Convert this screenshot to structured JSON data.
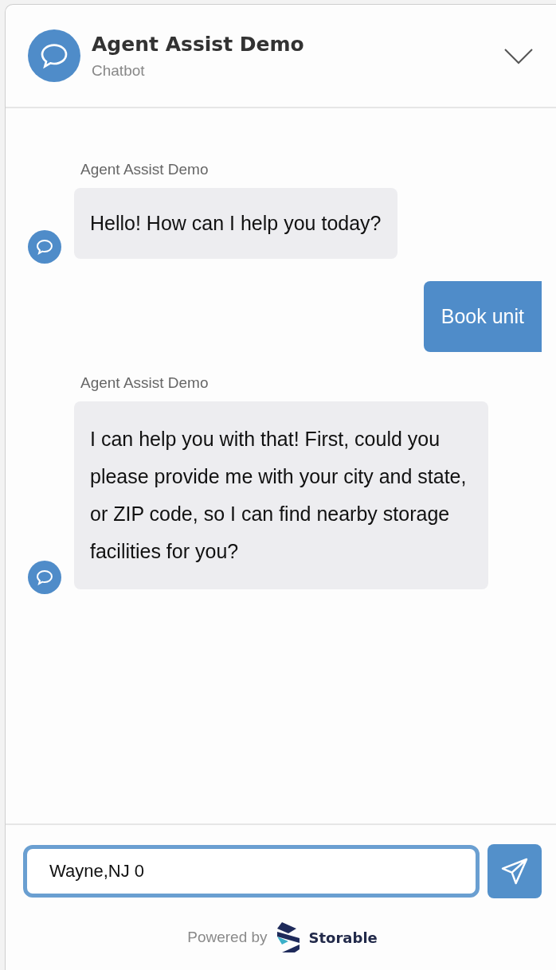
{
  "header": {
    "title": "Agent Assist Demo",
    "subtitle": "Chatbot",
    "expanded": true
  },
  "messages": [
    {
      "kind": "bot",
      "sender": "Agent Assist Demo",
      "text": "Hello! How can I help you today?"
    },
    {
      "kind": "user",
      "text": "Book unit"
    },
    {
      "kind": "bot",
      "sender": "Agent Assist Demo",
      "text": "I can help you with that! First, could you please provide me with your city and state, or ZIP code, so I can find nearby storage facilities for you?"
    }
  ],
  "composer": {
    "value": "Wayne,NJ 0"
  },
  "footer": {
    "powered_by": "Powered by",
    "brand": "Storable"
  }
}
